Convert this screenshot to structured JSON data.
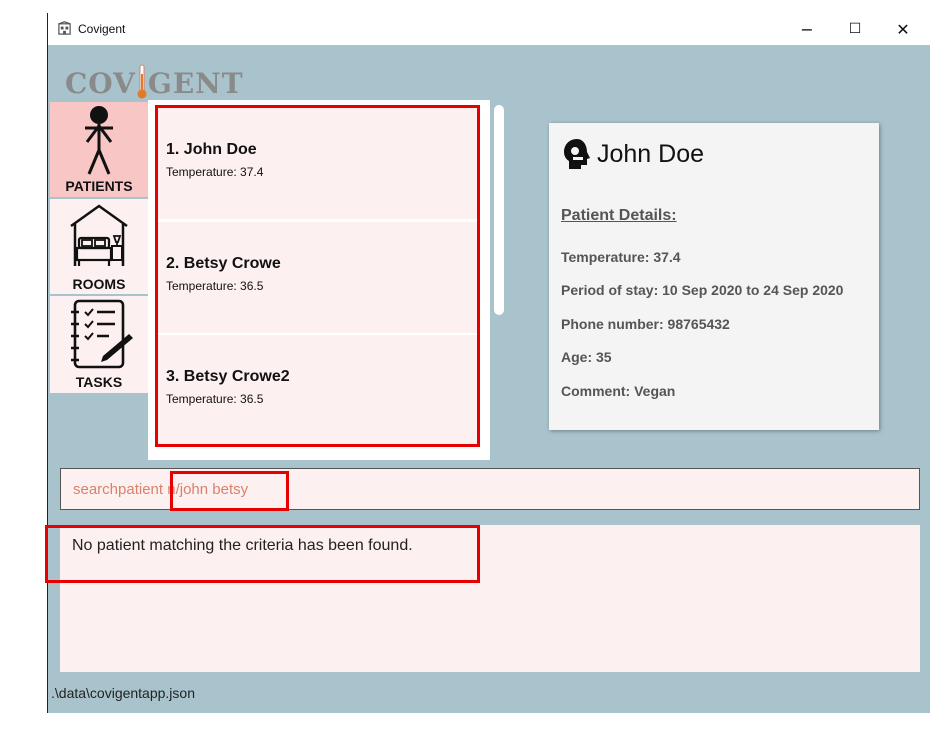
{
  "window": {
    "title": "Covigent",
    "minimize": "−",
    "maximize": "☐",
    "close": "✕"
  },
  "logo": {
    "left": "COV",
    "right": "GENT"
  },
  "sidebar": {
    "items": [
      {
        "label": "PATIENTS",
        "icon": "person-icon",
        "active": true
      },
      {
        "label": "ROOMS",
        "icon": "bedroom-icon",
        "active": false
      },
      {
        "label": "TASKS",
        "icon": "checklist-icon",
        "active": false
      }
    ]
  },
  "patients": [
    {
      "name": "1.  John Doe",
      "temperature": "Temperature: 37.4"
    },
    {
      "name": "2.  Betsy Crowe",
      "temperature": "Temperature: 36.5"
    },
    {
      "name": "3.  Betsy Crowe2",
      "temperature": "Temperature: 36.5"
    }
  ],
  "detail": {
    "name": "John Doe",
    "subtitle": "Patient Details:",
    "temperature": "Temperature: 37.4",
    "stay": "Period of stay: 10 Sep 2020 to 24 Sep 2020",
    "phone": "Phone number: 98765432",
    "age": "Age: 35",
    "comment": "Comment: Vegan"
  },
  "command": {
    "value": "searchpatient n/john betsy"
  },
  "result": {
    "text": "No patient matching the criteria has been found."
  },
  "status": {
    "path": ".\\data\\covigentapp.json"
  },
  "colors": {
    "background": "#a9c3cc",
    "card": "#fdf0f0",
    "active_tab": "#f9c6c6",
    "highlight": "#e60000",
    "command_text": "#d9826a"
  }
}
